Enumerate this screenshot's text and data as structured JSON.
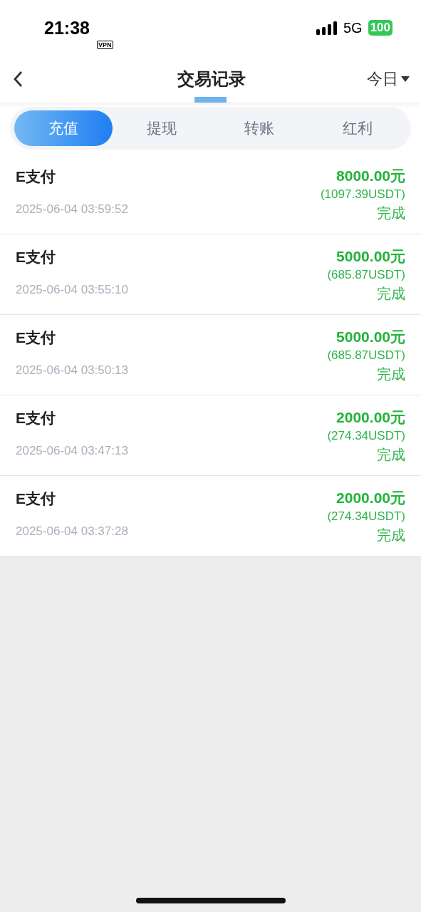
{
  "status_bar": {
    "time": "21:38",
    "vpn": "VPN",
    "network": "5G",
    "battery": "100"
  },
  "header": {
    "title": "交易记录",
    "filter": "今日"
  },
  "tabs": [
    {
      "label": "充值",
      "selected": true
    },
    {
      "label": "提现",
      "selected": false
    },
    {
      "label": "转账",
      "selected": false
    },
    {
      "label": "红利",
      "selected": false
    }
  ],
  "records": [
    {
      "method": "E支付",
      "time": "2025-06-04 03:59:52",
      "amount": "8000.00元",
      "usdt": "(1097.39USDT)",
      "status": "完成"
    },
    {
      "method": "E支付",
      "time": "2025-06-04 03:55:10",
      "amount": "5000.00元",
      "usdt": "(685.87USDT)",
      "status": "完成"
    },
    {
      "method": "E支付",
      "time": "2025-06-04 03:50:13",
      "amount": "5000.00元",
      "usdt": "(685.87USDT)",
      "status": "完成"
    },
    {
      "method": "E支付",
      "time": "2025-06-04 03:47:13",
      "amount": "2000.00元",
      "usdt": "(274.34USDT)",
      "status": "完成"
    },
    {
      "method": "E支付",
      "time": "2025-06-04 03:37:28",
      "amount": "2000.00元",
      "usdt": "(274.34USDT)",
      "status": "完成"
    }
  ]
}
